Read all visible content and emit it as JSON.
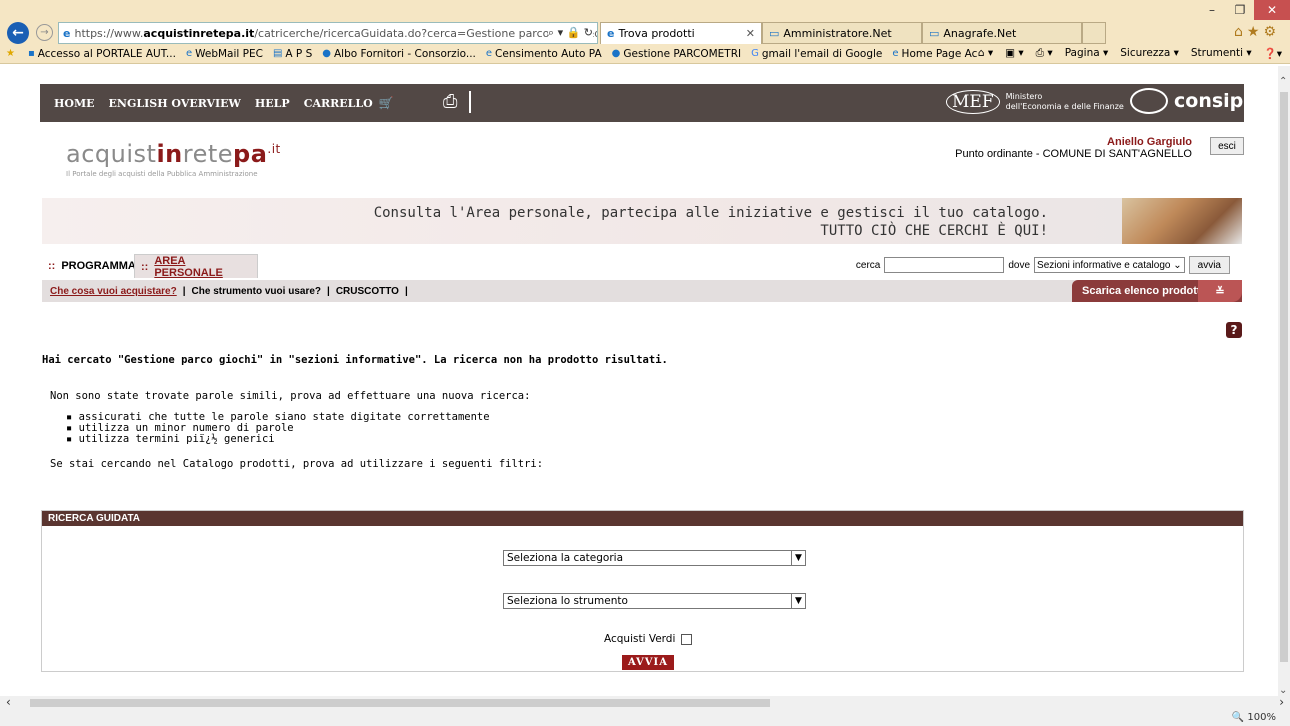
{
  "browser": {
    "url_prefix": "https://www.",
    "url_domain": "acquistinretepa.it",
    "url_rest": "/catricerche/ricercaGuidata.do?cerca=Gestione parco giochi&dove=info&adl",
    "tabs": [
      {
        "label": "Trova prodotti"
      },
      {
        "label": "Amministratore.Net"
      },
      {
        "label": "Anagrafe.Net"
      }
    ],
    "favorites": [
      {
        "label": "Accesso al PORTALE AUT..."
      },
      {
        "label": "WebMail PEC"
      },
      {
        "label": "A P S"
      },
      {
        "label": "Albo Fornitori - Consorzio..."
      },
      {
        "label": "Censimento Auto PA"
      },
      {
        "label": "Gestione PARCOMETRI"
      },
      {
        "label": "gmail l'email di Google"
      },
      {
        "label": "Home Page Acquistinrete"
      }
    ],
    "tools": {
      "pagina": "Pagina ▾",
      "sicurezza": "Sicurezza ▾",
      "strumenti": "Strumenti ▾"
    },
    "zoom": "🔍 100%"
  },
  "site_nav": {
    "home": "HOME",
    "english": "ENGLISH OVERVIEW",
    "help": "HELP",
    "carrello": "CARRELLO",
    "mef_logo": "MEF",
    "mef_line1": "Ministero",
    "mef_line2": "dell'Economia e delle Finanze",
    "consip": "consip"
  },
  "logo": {
    "part1": "acquist",
    "part2": "in",
    "part3": "rete",
    "part4": "pa",
    "suffix": ".it",
    "tagline": "Il Portale degli acquisti della Pubblica Amministrazione"
  },
  "user": {
    "name": "Aniello Gargiulo",
    "role": "Punto ordinante - COMUNE DI SANT'AGNELLO",
    "logout": "esci"
  },
  "banner": {
    "line1": "Consulta l'Area personale, partecipa alle iniziative e gestisci il tuo catalogo.",
    "line2": "TUTTO CIÒ CHE CERCHI È QUI!"
  },
  "tabs": {
    "programma": "PROGRAMMA",
    "area_personale": "AREA PERSONALE"
  },
  "search": {
    "cerca_label": "cerca",
    "dove_label": "dove",
    "dove_value": "Sezioni informative e catalogo",
    "button": "avvia"
  },
  "subnav": {
    "item1": "Che cosa vuoi acquistare?",
    "item2": "Che strumento vuoi usare?",
    "item3": "CRUSCOTTO",
    "scarica": "Scarica elenco prodotti"
  },
  "results": {
    "main": "Hai cercato \"Gestione parco giochi\" in \"sezioni informative\". La ricerca non ha prodotto risultati.",
    "intro": "Non sono state trovate parole simili, prova ad effettuare una nuova ricerca:",
    "tips": [
      "assicurati che tutte le parole siano state digitate correttamente",
      "utilizza un minor numero di parole",
      "utilizza termini piï¿½ generici"
    ],
    "filters": "Se stai cercando nel Catalogo prodotti, prova ad utilizzare i seguenti filtri:"
  },
  "guided": {
    "header": "RICERCA GUIDATA",
    "category_placeholder": "Seleziona la categoria",
    "tool_placeholder": "Seleziona lo strumento",
    "verdi_label": "Acquisti Verdi",
    "button": "AVVIA"
  }
}
